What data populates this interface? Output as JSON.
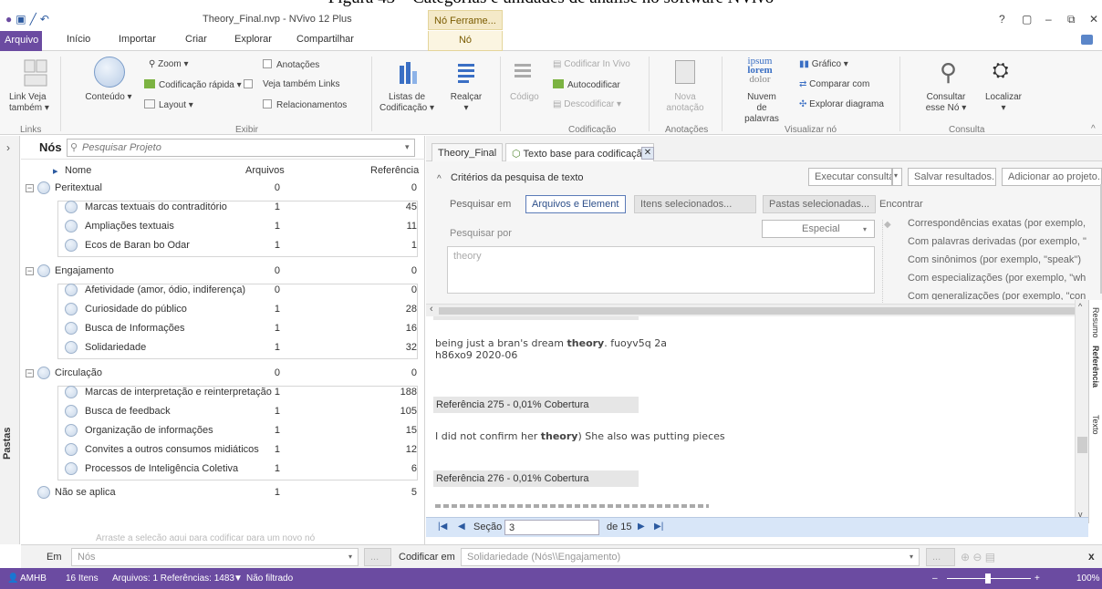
{
  "caption": {
    "text": "Figura 43 – Categorias e unidades de análise no software NVivo"
  },
  "window": {
    "title": "Theory_Final.nvp - NVivo 12 Plus",
    "context_tab": "Nó Ferrame...",
    "help": "?",
    "restore": "▢",
    "minimize": "–",
    "maximize": "⧉",
    "close": "✕"
  },
  "tabs": [
    "Arquivo",
    "Início",
    "Importar",
    "Criar",
    "Explorar",
    "Compartilhar"
  ],
  "context_node_tab": "Nó",
  "ribbon": {
    "links": {
      "label": "Link Veja também ▾",
      "group": "Links"
    },
    "exibir": {
      "conteudo": "Conteúdo ▾",
      "zoom": "Zoom ▾",
      "codificacao_rapida": "Codificação rápida ▾",
      "layout": "Layout ▾",
      "anotacoes": "Anotações",
      "veja_tambem_links": "Veja também Links",
      "relacionamentos": "Relacionamentos",
      "group": "Exibir"
    },
    "listas": "Listas de Codificação ▾",
    "realcar": "Realçar ▾",
    "codificacao": {
      "codigo": "Código",
      "codificar_in_vivo": "Codificar In Vivo",
      "autocodificar": "Autocodificar",
      "descodificar": "Descodificar ▾",
      "group": "Codificação"
    },
    "anotacoes": {
      "nova": "Nova anotação",
      "group": "Anotações"
    },
    "visualizar": {
      "nuvem": "Nuvem de palavras",
      "grafico": "Gráfico ▾",
      "comparar": "Comparar com",
      "explorar": "Explorar diagrama",
      "group": "Visualizar nó"
    },
    "consulta": {
      "consultar": "Consultar esse Nó ▾",
      "localizar": "Localizar ▾",
      "group": "Consulta"
    }
  },
  "left_sidebar": {
    "label": "Pastas"
  },
  "nodes": {
    "title": "Nós",
    "search_placeholder": "Pesquisar Projeto",
    "columns": {
      "name": "Nome",
      "files": "Arquivos",
      "refs": "Referência"
    },
    "groups": [
      {
        "name": "Peritextual",
        "files": "0",
        "refs": "0",
        "children": [
          {
            "name": "Marcas textuais do contraditório",
            "files": "1",
            "refs": "45"
          },
          {
            "name": "Ampliações textuais",
            "files": "1",
            "refs": "11"
          },
          {
            "name": "Ecos de Baran bo Odar",
            "files": "1",
            "refs": "1"
          }
        ]
      },
      {
        "name": "Engajamento",
        "files": "0",
        "refs": "0",
        "children": [
          {
            "name": "Afetividade (amor, ódio, indiferença)",
            "files": "0",
            "refs": "0"
          },
          {
            "name": "Curiosidade do público",
            "files": "1",
            "refs": "28"
          },
          {
            "name": "Busca de Informações",
            "files": "1",
            "refs": "16"
          },
          {
            "name": "Solidariedade",
            "files": "1",
            "refs": "32"
          }
        ]
      },
      {
        "name": "Circulação",
        "files": "0",
        "refs": "0",
        "children": [
          {
            "name": "Marcas de interpretação e reinterpretação",
            "files": "1",
            "refs": "188"
          },
          {
            "name": "Busca de feedback",
            "files": "1",
            "refs": "105"
          },
          {
            "name": "Organização de informações",
            "files": "1",
            "refs": "15"
          },
          {
            "name": "Convites a outros consumos midiáticos",
            "files": "1",
            "refs": "12"
          },
          {
            "name": "Processos de Inteligência Coletiva",
            "files": "1",
            "refs": "6"
          }
        ]
      }
    ],
    "extra": {
      "name": "Não se aplica",
      "files": "1",
      "refs": "5"
    },
    "drag_hint": "Arraste a seleção aqui para codificar para um novo nó"
  },
  "doc_tabs": {
    "theory_final": "Theory_Final",
    "texto_base": "Texto base para codificação"
  },
  "criteria": {
    "title": "Critérios da pesquisa de texto",
    "executar": "Executar consulta",
    "salvar": "Salvar resultados...",
    "adicionar": "Adicionar ao projeto...",
    "pesquisar_em": "Pesquisar em",
    "arquivos_elementos": "Arquivos e Element",
    "itens_selecionados": "Itens selecionados...",
    "pastas_selecionadas": "Pastas selecionadas...",
    "pesquisar_por": "Pesquisar por",
    "query": "theory",
    "especial": "Especial",
    "encontrar": "Encontrar",
    "options": [
      "Correspondências exatas (por exemplo,",
      "Com palavras derivadas (por exemplo, \"",
      "Com sinônimos (por exemplo, \"speak\")",
      "Com especializações (por exemplo, \"wh",
      "Com generalizações (por exemplo, \"con"
    ]
  },
  "results": {
    "line1_pre": "being just a bran's dream ",
    "line1_bold": "theory",
    "line1_post": ".        fuoyv5q       2a",
    "line1b": "h86xo9       2020-06",
    "ref275": "Referência 275 - 0,01% Cobertura",
    "line2_pre": "I did not confirm her ",
    "line2_bold": "theory",
    "line2_post": ") She also was putting pieces",
    "ref276": "Referência 276 - 0,01% Cobertura"
  },
  "side_tabs": [
    "Resumo",
    "Referência",
    "Texto"
  ],
  "pager": {
    "secao_label": "Seção",
    "secao_value": "3",
    "total": "de 15"
  },
  "bottom": {
    "em": "Em",
    "nos": "Nós",
    "codificar_em": "Codificar em",
    "target": "Solidariedade (Nós\\\\Engajamento)"
  },
  "status": {
    "user": "AMHB",
    "items": "16 Itens",
    "summary": "Arquivos: 1 Referências: 1483",
    "filter": "Não filtrado",
    "zoom": "100%"
  }
}
